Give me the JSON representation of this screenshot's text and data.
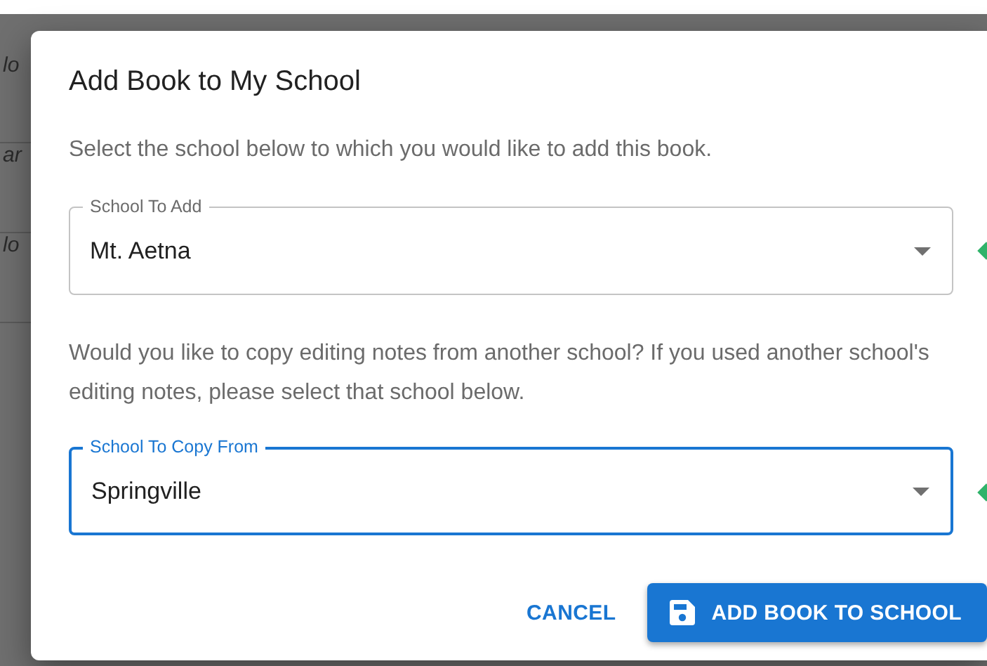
{
  "background": {
    "fragments": [
      "lo",
      "ar",
      "lo"
    ]
  },
  "dialog": {
    "title": "Add Book to My School",
    "intro": "Select the school below to which you would like to add this book.",
    "fields": [
      {
        "label": "School To Add",
        "value": "Mt. Aetna",
        "focused": false
      },
      {
        "label": "School To Copy From",
        "value": "Springville",
        "focused": true
      }
    ],
    "copy_note": "Would you like to copy editing notes from another school? If you used another school's editing notes, please select that school below.",
    "buttons": [
      {
        "label": "CANCEL",
        "kind": "text"
      },
      {
        "label": "ADD BOOK TO SCHOOL",
        "kind": "primary"
      }
    ]
  }
}
